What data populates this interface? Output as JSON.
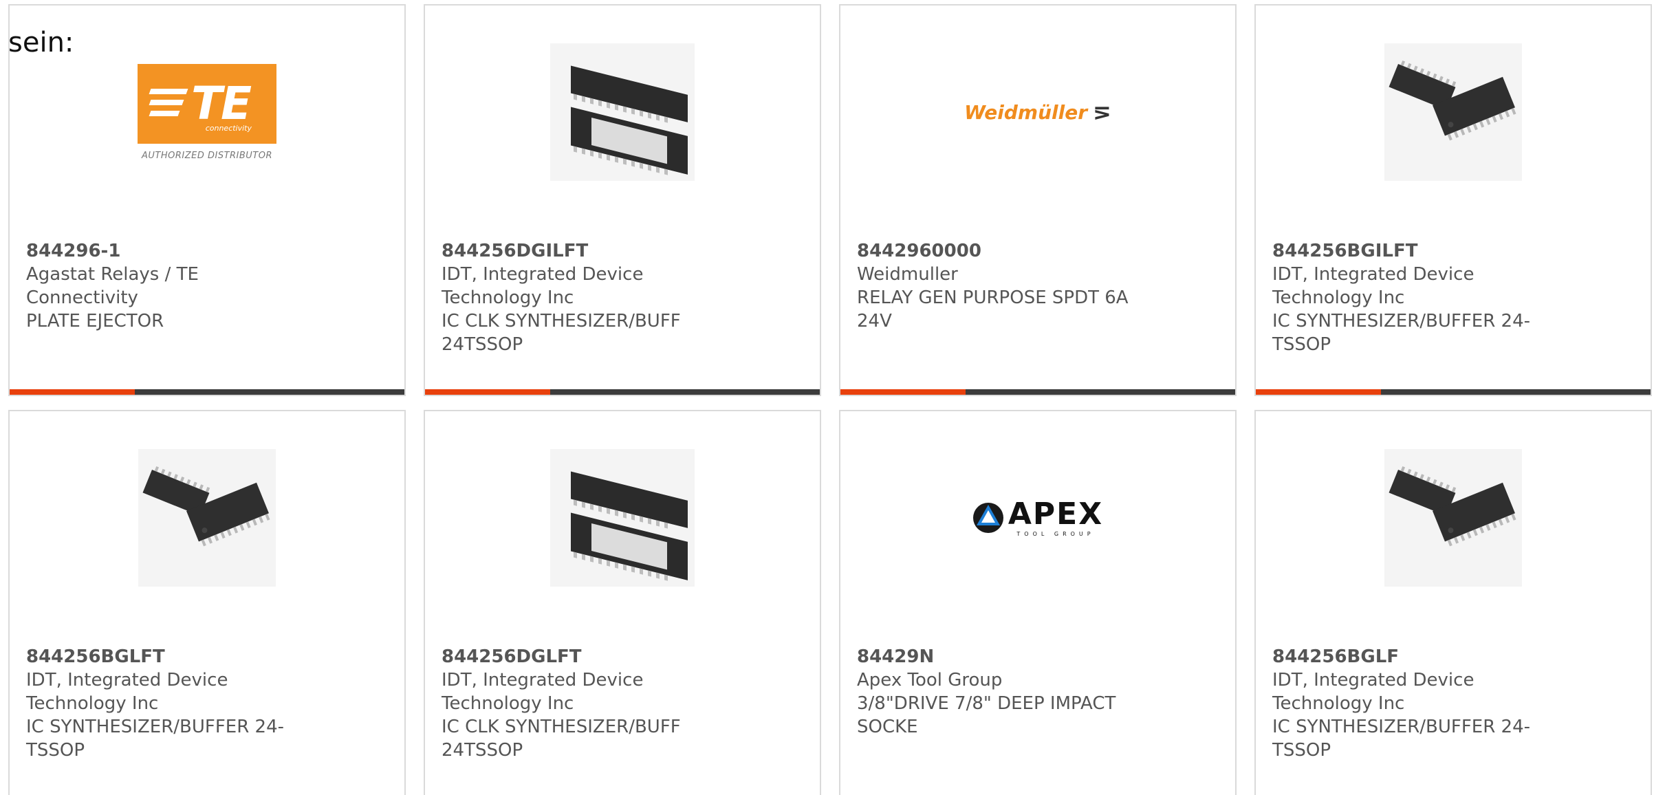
{
  "lead_text": "sein:",
  "colors": {
    "accent": "#e8400c",
    "bar": "#3c3c3c",
    "border": "#dadada",
    "te_orange": "#f39323",
    "weidmuller_orange": "#f08c1e"
  },
  "cards": [
    {
      "part_number": "844296-1",
      "manufacturer": "Agastat Relays / TE Connectivity",
      "description": "PLATE EJECTOR",
      "image": "te-connectivity-logo",
      "logo": {
        "letters": "TE",
        "subtext": "connectivity",
        "tagline": "AUTHORIZED DISTRIBUTOR"
      }
    },
    {
      "part_number": "844256DGILFT",
      "manufacturer": "IDT, Integrated Device Technology Inc",
      "description": "IC CLK SYNTHESIZER/BUFF 24TSSOP",
      "image": "tssop-exposed-pad-chip-icon"
    },
    {
      "part_number": "8442960000",
      "manufacturer": "Weidmuller",
      "description": "RELAY GEN PURPOSE SPDT 6A 24V",
      "image": "weidmuller-logo",
      "logo": {
        "wordmark": "Weidmüller",
        "mark": "⋝"
      }
    },
    {
      "part_number": "844256BGILFT",
      "manufacturer": "IDT, Integrated Device Technology Inc",
      "description": "IC SYNTHESIZER/BUFFER 24-TSSOP",
      "image": "tssop-chip-icon"
    },
    {
      "part_number": "844256BGLFT",
      "manufacturer": "IDT, Integrated Device Technology Inc",
      "description": "IC SYNTHESIZER/BUFFER 24-TSSOP",
      "image": "tssop-chip-icon"
    },
    {
      "part_number": "844256DGLFT",
      "manufacturer": "IDT, Integrated Device Technology Inc",
      "description": "IC CLK SYNTHESIZER/BUFF 24TSSOP",
      "image": "tssop-exposed-pad-chip-icon"
    },
    {
      "part_number": "84429N",
      "manufacturer": "Apex Tool Group",
      "description": "3/8\"DRIVE 7/8\" DEEP IMPACT SOCKE",
      "image": "apex-tool-group-logo",
      "logo": {
        "wordmark": "APEX",
        "subtext": "TOOL GROUP"
      }
    },
    {
      "part_number": "844256BGLF",
      "manufacturer": "IDT, Integrated Device Technology Inc",
      "description": "IC SYNTHESIZER/BUFFER 24-TSSOP",
      "image": "tssop-chip-icon"
    }
  ]
}
